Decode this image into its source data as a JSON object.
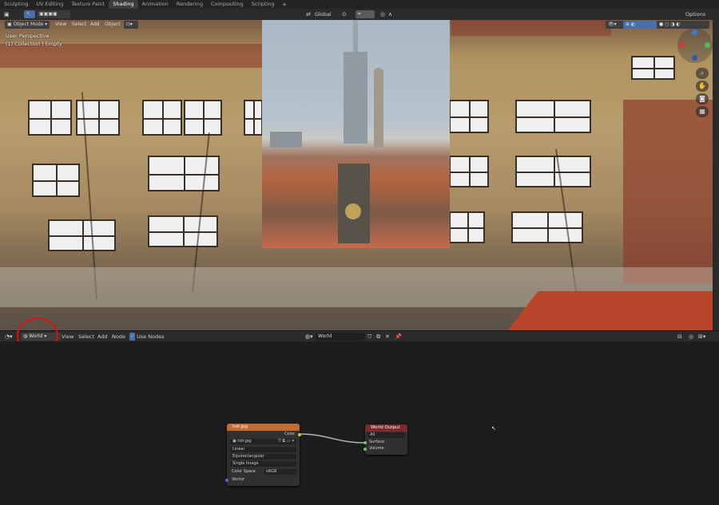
{
  "workspace_tabs": [
    "Sculpting",
    "UV Editing",
    "Texture Paint",
    "Shading",
    "Animation",
    "Rendering",
    "Compositing",
    "Scripting"
  ],
  "workspace_add": "+",
  "active_tab": "Shading",
  "top": {
    "transform_orientation": "Global",
    "options": "Options"
  },
  "viewport": {
    "mode": "Object Mode",
    "menu_view": "View",
    "menu_select": "Select",
    "menu_add": "Add",
    "menu_object": "Object",
    "overlay_line1": "User Perspective",
    "overlay_line2": "(1) Collection | Empty"
  },
  "node_editor": {
    "world_dropdown": "World",
    "menu_view": "View",
    "menu_select": "Select",
    "menu_add": "Add",
    "menu_node": "Node",
    "use_nodes_label": "Use Nodes",
    "world_name": "World"
  },
  "env_node": {
    "title": "hdr.jpg",
    "output_color": "Color",
    "image_name": "hdr.jpg",
    "interpolation": "Linear",
    "projection": "Equirectangular",
    "source": "Single Image",
    "color_space_label": "Color Space",
    "color_space_value": "sRGB",
    "input_vector": "Vector"
  },
  "output_node": {
    "title": "World Output",
    "target": "All",
    "input_surface": "Surface",
    "input_volume": "Volume"
  },
  "colors": {
    "active_tab_bg": "#3d3d3d",
    "texture_node_header": "#c46b32",
    "output_node_header": "#7d2a2e",
    "socket_color": "#c7c729",
    "socket_vector": "#6363c7",
    "socket_shader": "#63c763",
    "annotation": "#e01010"
  }
}
